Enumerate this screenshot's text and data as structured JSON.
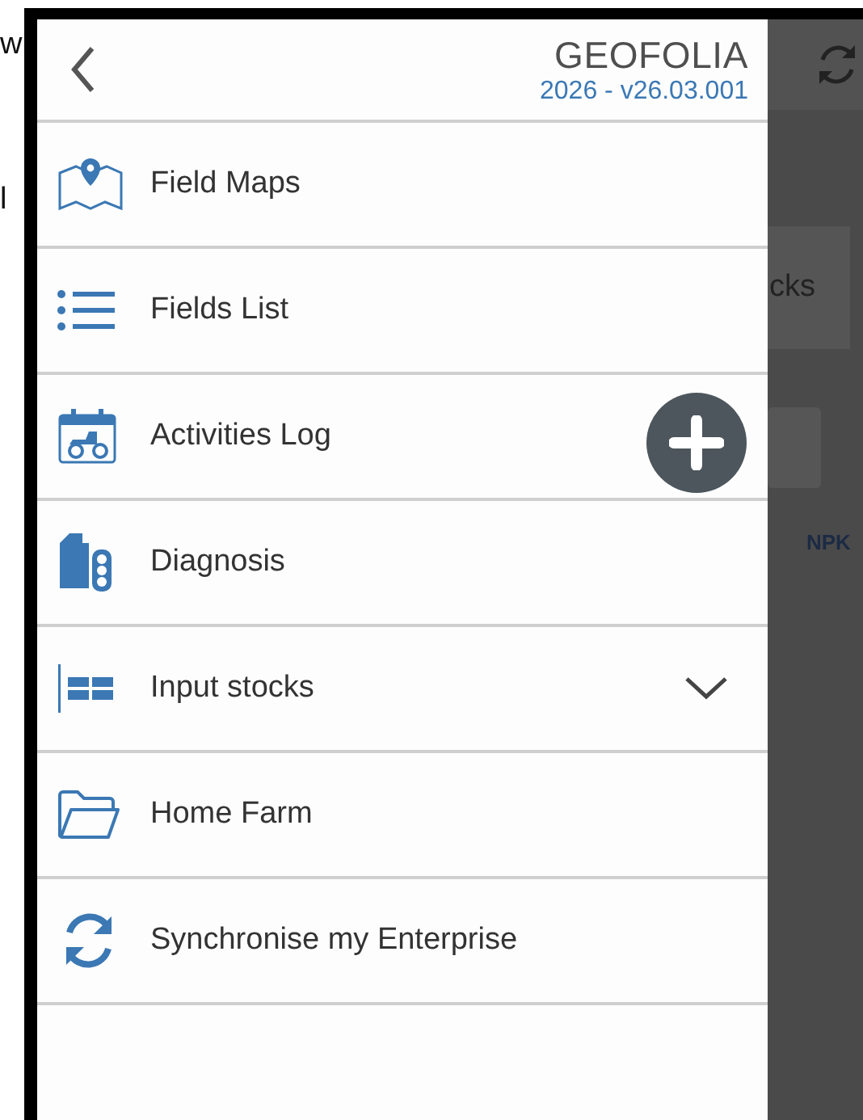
{
  "background_fragments": [
    "w",
    "l"
  ],
  "drawer": {
    "title": "GEOFOLIA",
    "version": "2026 - v26.03.001",
    "items": [
      {
        "label": "Field Maps",
        "kind": "link"
      },
      {
        "label": "Fields List",
        "kind": "link"
      },
      {
        "label": "Activities Log",
        "kind": "link"
      },
      {
        "label": "Diagnosis",
        "kind": "link"
      },
      {
        "label": "Input stocks",
        "kind": "group",
        "expanded": false
      },
      {
        "label": "Home Farm",
        "kind": "link"
      },
      {
        "label": "Synchronise my Enterprise",
        "kind": "link"
      }
    ]
  },
  "background_app": {
    "card_text": "cks",
    "label": "NPK"
  }
}
